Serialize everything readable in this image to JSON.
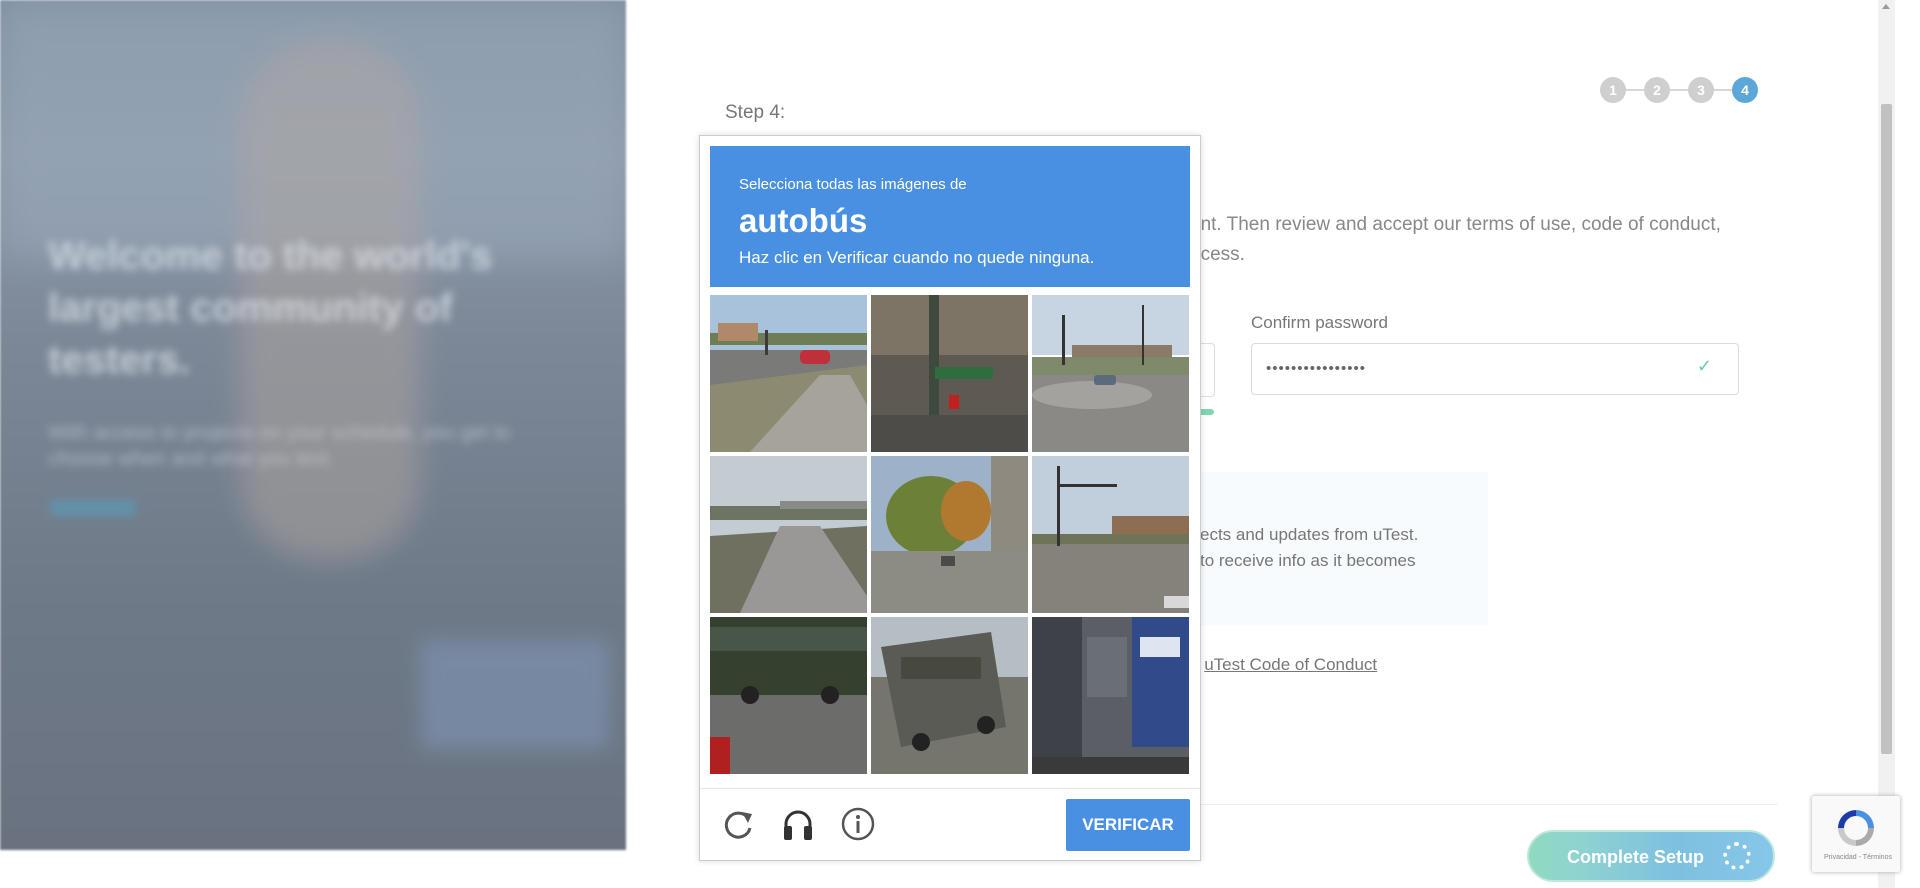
{
  "hero": {
    "title": "Welcome to the world's largest community of testers.",
    "subtitle": "With access to projects on your schedule, you get to choose when and what you test.",
    "link": "Learn more"
  },
  "form": {
    "step_label": "Step 4:",
    "steps": [
      "1",
      "2",
      "3",
      "4"
    ],
    "active_step": 4,
    "intro_line1": "unt. Then review and accept our terms of use, code of conduct,",
    "intro_line2": "ocess.",
    "confirm_password_label": "Confirm password",
    "confirm_password_value": "••••••••••••••••",
    "info_line1": "ects and updates from uTest.",
    "info_line2": "to receive info as it becomes",
    "coc_prefix": "e ",
    "coc_link": "uTest Code of Conduct",
    "complete_button": "Complete Setup"
  },
  "captcha": {
    "instruction": "Selecciona todas las imágenes de",
    "target": "autobús",
    "hint": "Haz clic en Verificar cuando no quede ninguna.",
    "verify_button": "VERIFICAR",
    "tiles": [
      "street-with-red-car",
      "traffic-light-street-sign",
      "parking-lot-intersection",
      "overpass-road",
      "tree-lined-street",
      "intersection-with-signals",
      "green-bus-side",
      "bus-on-road",
      "bus-close-up"
    ]
  },
  "recaptcha_badge": {
    "terms": "Privacidad - Términos"
  },
  "colors": {
    "captcha_blue": "#4a90e2",
    "step_active": "#5ba8d8",
    "success_green": "#6bcba5"
  }
}
